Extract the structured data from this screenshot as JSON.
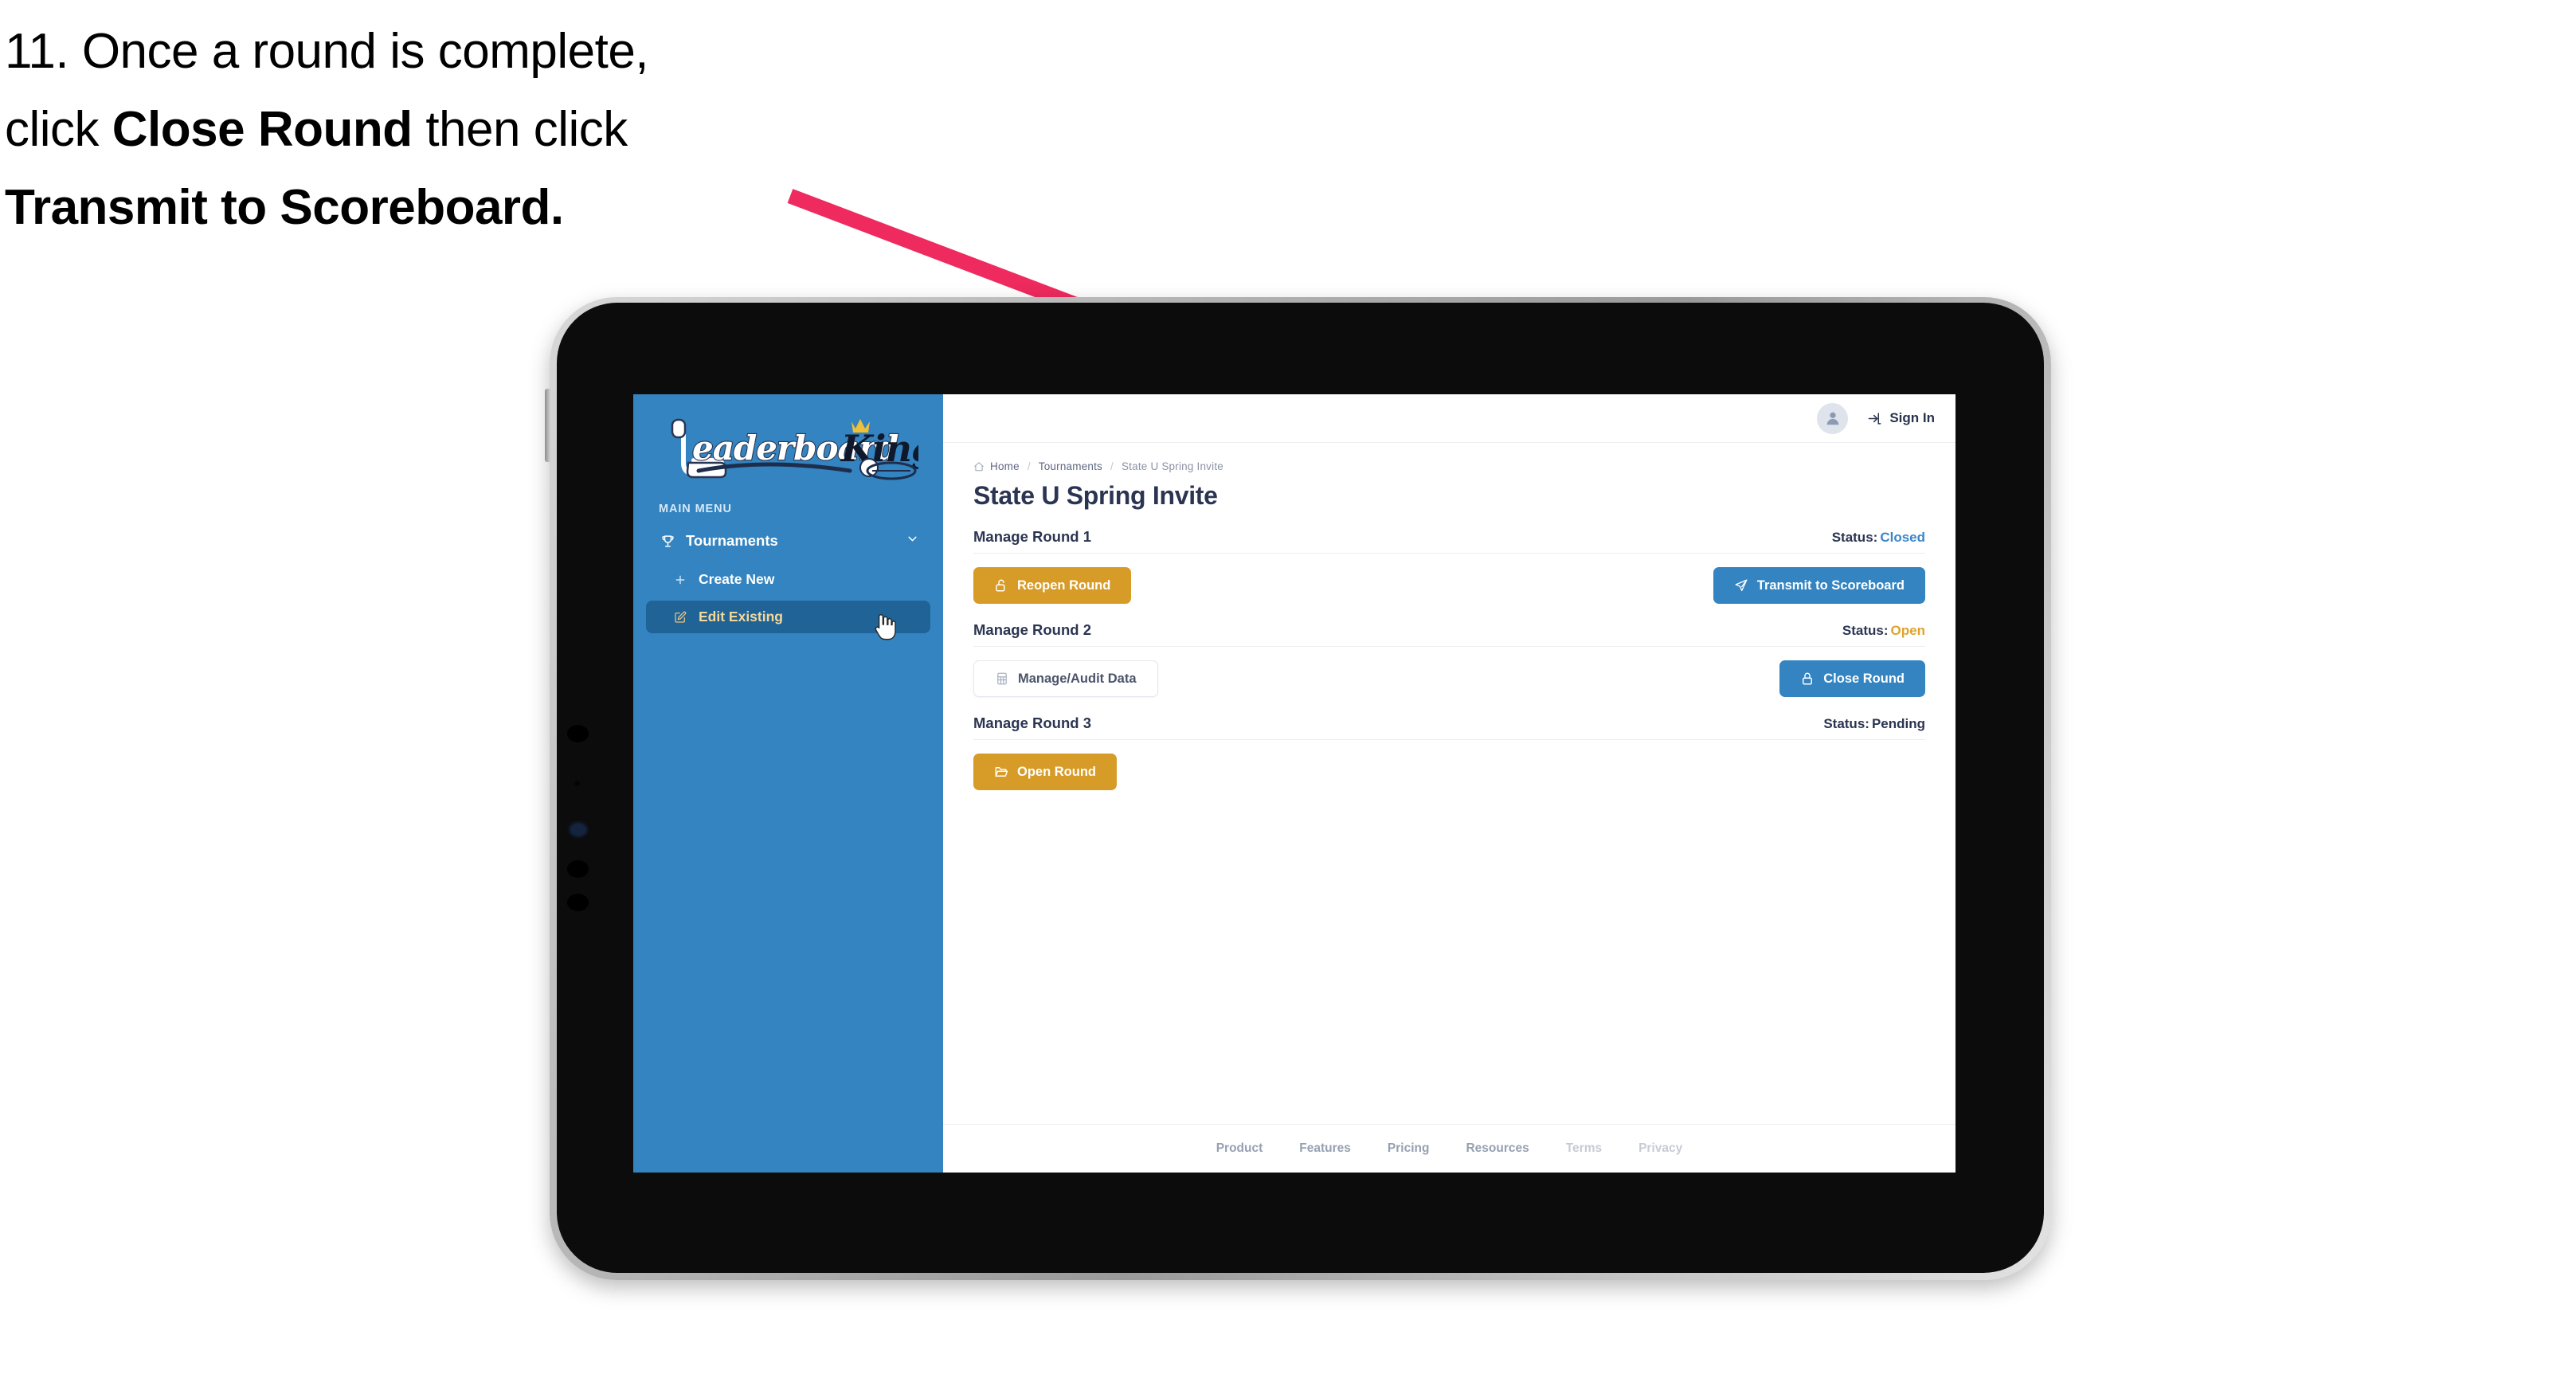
{
  "caption": {
    "line1_prefix": "11. Once a round is complete,",
    "line2_prefix": "click ",
    "line2_bold": "Close Round",
    "line2_suffix": " then click",
    "line3_bold": "Transmit to Scoreboard."
  },
  "colors": {
    "arrow": "#EE2A5E",
    "sidebar_blue": "#3384C0",
    "sidebar_active": "#1F6397",
    "sidebar_active_text": "#F3D89A",
    "brand_blue": "#3384C0",
    "gold": "#D79B28",
    "status_closed": "#3B86C8",
    "status_open": "#E0A22B",
    "status_pending": "#2B3552",
    "title_navy": "#2B3552"
  },
  "app": {
    "sidebar": {
      "logo_text_left": "Leaderboard",
      "logo_text_right": "King",
      "menu_label": "MAIN MENU",
      "items": [
        {
          "label": "Tournaments",
          "icon": "trophy-icon",
          "chevron": "chevron-down-icon",
          "active": false
        },
        {
          "label": "Create New",
          "icon": "plus-icon",
          "active": false
        },
        {
          "label": "Edit Existing",
          "icon": "edit-pencil-icon",
          "active": true
        }
      ]
    },
    "topbar": {
      "avatar_icon": "user-avatar-icon",
      "signin_icon": "sign-in-arrow-icon",
      "signin_label": "Sign In"
    },
    "breadcrumb": {
      "home_icon": "home-icon",
      "items": [
        "Home",
        "Tournaments",
        "State U Spring Invite"
      ],
      "separator": "/"
    },
    "page_title": "State U Spring Invite",
    "rounds": [
      {
        "title": "Manage Round 1",
        "status_label": "Status:",
        "status_value": "Closed",
        "status_color": "#3B86C8",
        "left_button": {
          "label": "Reopen Round",
          "style": "gold",
          "icon": "unlock-icon"
        },
        "right_button": {
          "label": "Transmit to Scoreboard",
          "style": "blue",
          "icon": "paper-plane-icon"
        }
      },
      {
        "title": "Manage Round 2",
        "status_label": "Status:",
        "status_value": "Open",
        "status_color": "#E0A22B",
        "left_button": {
          "label": "Manage/Audit Data",
          "style": "ghost",
          "icon": "table-grid-icon"
        },
        "right_button": {
          "label": "Close Round",
          "style": "blue",
          "icon": "lock-icon"
        }
      },
      {
        "title": "Manage Round 3",
        "status_label": "Status:",
        "status_value": "Pending",
        "status_color": "#2B3552",
        "left_button": {
          "label": "Open Round",
          "style": "gold",
          "icon": "folder-open-icon"
        },
        "right_button": null
      }
    ],
    "footer": {
      "links": [
        {
          "label": "Product",
          "dim": false
        },
        {
          "label": "Features",
          "dim": false
        },
        {
          "label": "Pricing",
          "dim": false
        },
        {
          "label": "Resources",
          "dim": false
        },
        {
          "label": "Terms",
          "dim": true
        },
        {
          "label": "Privacy",
          "dim": true
        }
      ]
    },
    "cursor": {
      "icon": "pointing-hand-cursor"
    }
  }
}
